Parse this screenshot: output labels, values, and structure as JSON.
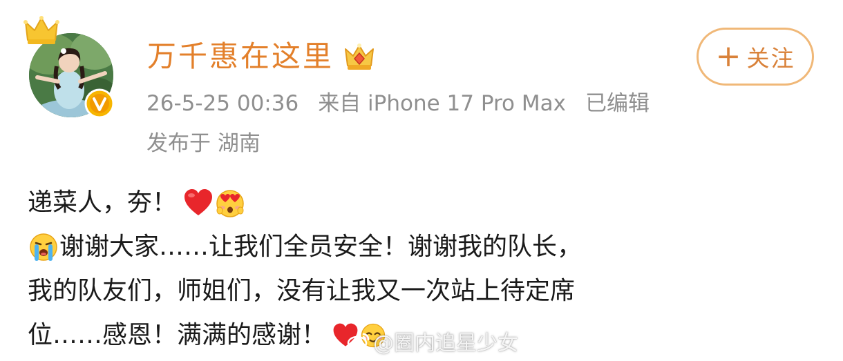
{
  "author": {
    "name": "万千惠在这里",
    "avatar_icon": "avatar-photo",
    "crown_icon": "crown-icon",
    "verified_icon": "verified-v-icon",
    "vip_badge_icon": "vip-crown-badge-icon"
  },
  "meta": {
    "datetime": "26-5-25 00:36",
    "source": "来自 iPhone 17 Pro Max",
    "edited": "已编辑",
    "location": "发布于 湖南"
  },
  "follow_button": {
    "plus": "+",
    "label": "关注"
  },
  "post": {
    "line1_text": "递菜人，夯！",
    "line2_text": "谢谢大家……让我们全员安全！谢谢我的队长，",
    "line3_text": "我的队友们，师姐们，没有让我又一次站上待定席",
    "line4_text": "位……感恩！满满的感谢！",
    "emojis": [
      "red-heart-icon",
      "heart-eyes-face-icon",
      "crying-face-icon",
      "red-heart-icon",
      "blush-face-icon"
    ]
  },
  "watermark": {
    "text": "@圈内追星少女",
    "icon": "weibo-logo-icon"
  },
  "colors": {
    "username": "#e3802b",
    "meta": "#8f8f8f",
    "follow_border": "#f0b878",
    "follow_text": "#d9823a",
    "body_text": "#1a1a1a"
  }
}
